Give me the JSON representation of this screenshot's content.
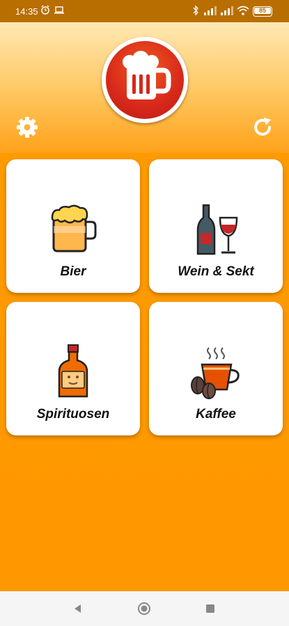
{
  "status_bar": {
    "time": "14:35",
    "battery": "85"
  },
  "header": {
    "logo_icon": "beer-mug-logo-icon",
    "settings_icon": "gear-icon",
    "refresh_icon": "refresh-icon"
  },
  "categories": [
    {
      "label": "Bier",
      "icon": "beer-icon"
    },
    {
      "label": "Wein & Sekt",
      "icon": "wine-icon"
    },
    {
      "label": "Spirituosen",
      "icon": "liquor-bottle-icon"
    },
    {
      "label": "Kaffee",
      "icon": "coffee-icon"
    }
  ],
  "nav_bar": {
    "back_icon": "back-icon",
    "home_icon": "home-icon",
    "recents_icon": "recents-icon"
  },
  "colors": {
    "accent": "#ff9800",
    "status_bar": "#b86e00",
    "logo_red": "#d7281a"
  }
}
